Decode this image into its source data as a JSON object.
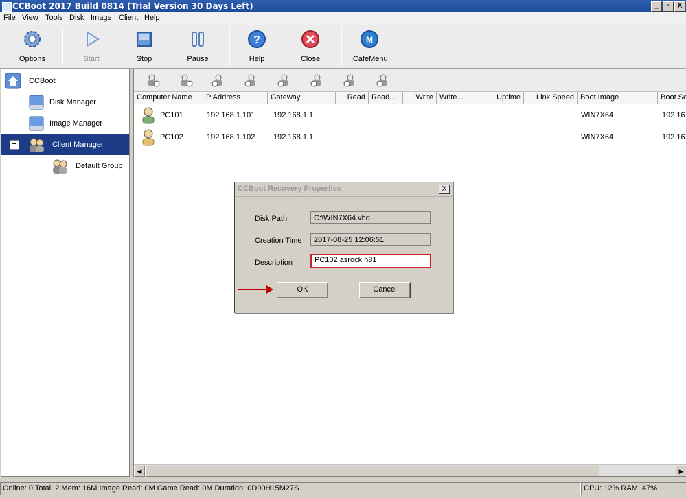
{
  "window": {
    "title": "CCBoot 2017 Build 0814 (Trial Version 30 Days Left)",
    "controls": [
      "_",
      "▫",
      "X"
    ]
  },
  "menu": [
    "File",
    "View",
    "Tools",
    "Disk",
    "Image",
    "Client",
    "Help"
  ],
  "toolbar": {
    "buttons": [
      {
        "label": "Options",
        "icon": "gear-icon"
      },
      {
        "label": "Start",
        "icon": "play-icon",
        "disabled": true
      },
      {
        "label": "Stop",
        "icon": "stop-icon"
      },
      {
        "label": "Pause",
        "icon": "pause-icon"
      },
      {
        "label": "Help",
        "icon": "help-icon"
      },
      {
        "label": "Close",
        "icon": "close-circle-icon"
      },
      {
        "label": "iCafeMenu",
        "icon": "icafe-icon"
      }
    ]
  },
  "tree": {
    "root": "CCBoot",
    "items": [
      {
        "label": "Disk Manager"
      },
      {
        "label": "Image Manager"
      },
      {
        "label": "Client Manager",
        "selected": true,
        "expander": "−"
      },
      {
        "label": "Default Group"
      }
    ]
  },
  "client_table": {
    "columns": [
      "Computer Name",
      "IP Address",
      "Gateway",
      "Read",
      "Read...",
      "Write",
      "Write...",
      "Uptime",
      "Link Speed",
      "Boot Image",
      "Boot Se"
    ],
    "rows": [
      {
        "name": "PC101",
        "ip": "192.168.1.101",
        "gateway": "192.168.1.1",
        "boot_image": "WIN7X64",
        "boot_server": "192.16"
      },
      {
        "name": "PC102",
        "ip": "192.168.1.102",
        "gateway": "192.168.1.1",
        "boot_image": "WIN7X64",
        "boot_server": "192.16"
      }
    ]
  },
  "dialog": {
    "title": "CCBoot Recovery Properties",
    "disk_path_label": "Disk Path",
    "disk_path_value": "C:\\WIN7X64.vhd",
    "creation_time_label": "Creation Time",
    "creation_time_value": "2017-08-25 12:06:51",
    "description_label": "Description",
    "description_value": "PC102 asrock h81",
    "ok_label": "OK",
    "cancel_label": "Cancel",
    "close_glyph": "X"
  },
  "status": {
    "left": "Online: 0 Total: 2 Mem: 16M Image Read: 0M Game Read: 0M Duration: 0D00H15M27S",
    "right": "CPU: 12% RAM: 47%"
  },
  "colors": {
    "accent_selection": "#1d3c87",
    "highlight_border": "#c8232a",
    "arrow": "#c00000"
  }
}
